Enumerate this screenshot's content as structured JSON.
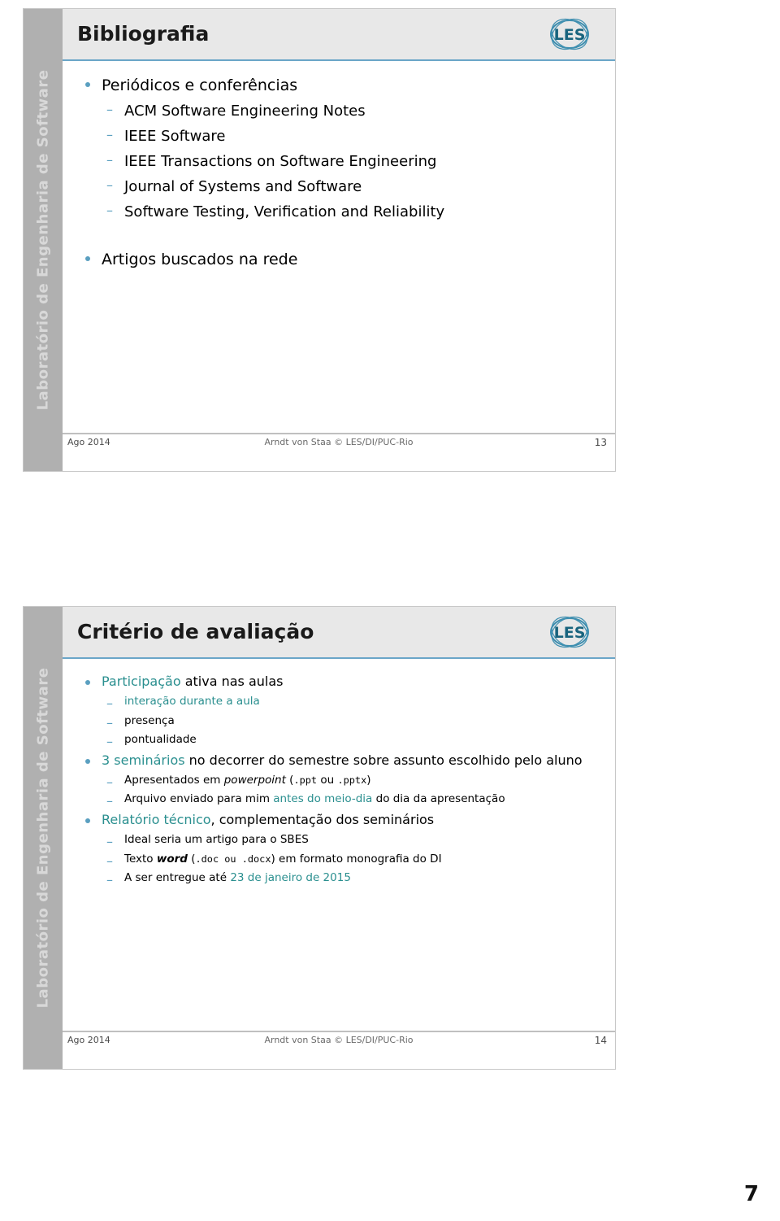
{
  "document": {
    "page_number": "7"
  },
  "slides": [
    {
      "title": "Bibliografia",
      "logo_text": "LES",
      "side_band": "Laboratório de Engenharia de Software",
      "bullets": [
        {
          "text": "Periódicos e conferências",
          "sub": [
            "ACM Software Engineering Notes",
            "IEEE Software",
            "IEEE Transactions on Software Engineering",
            "Journal of Systems and Software",
            "Software Testing, Verification and Reliability"
          ]
        },
        {
          "text": "Artigos buscados na rede",
          "sub": []
        }
      ],
      "footer": {
        "date": "Ago 2014",
        "center": "Arndt von Staa © LES/DI/PUC-Rio",
        "number": "13"
      }
    },
    {
      "title": "Critério de avaliação",
      "logo_text": "LES",
      "side_band": "Laboratório de Engenharia de Software",
      "groups": [
        {
          "bullet_parts": [
            {
              "text": "Participação",
              "style": "teal"
            },
            {
              "text": " ativa nas aulas",
              "style": "plain"
            }
          ],
          "sub": [
            [
              {
                "text": "interação durante a aula",
                "style": "teal"
              }
            ],
            [
              {
                "text": "presença",
                "style": "plain"
              }
            ],
            [
              {
                "text": "pontualidade",
                "style": "plain"
              }
            ]
          ]
        },
        {
          "bullet_parts": [
            {
              "text": "3 seminários",
              "style": "teal"
            },
            {
              "text": " no decorrer do semestre sobre assunto escolhido pelo aluno",
              "style": "plain"
            }
          ],
          "sub": [
            [
              {
                "text": "Apresentados em ",
                "style": "plain"
              },
              {
                "text": "powerpoint",
                "style": "ital"
              },
              {
                "text": " (",
                "style": "plain"
              },
              {
                "text": ".ppt",
                "style": "mono"
              },
              {
                "text": " ou ",
                "style": "plain"
              },
              {
                "text": ".pptx",
                "style": "mono"
              },
              {
                "text": ")",
                "style": "plain"
              }
            ],
            [
              {
                "text": "Arquivo enviado para mim ",
                "style": "plain"
              },
              {
                "text": "antes do meio-dia",
                "style": "teal"
              },
              {
                "text": " do dia da apresentação",
                "style": "plain"
              }
            ]
          ]
        },
        {
          "bullet_parts": [
            {
              "text": "Relatório técnico",
              "style": "teal"
            },
            {
              "text": ", complementação dos seminários",
              "style": "plain"
            }
          ],
          "sub": [
            [
              {
                "text": "Ideal seria um artigo para o SBES",
                "style": "plain"
              }
            ],
            [
              {
                "text": "Texto ",
                "style": "plain"
              },
              {
                "text": "word",
                "style": "bold-ital"
              },
              {
                "text": " (",
                "style": "plain"
              },
              {
                "text": ".doc",
                "style": "mono"
              },
              {
                "text": " ou ",
                "style": "mono"
              },
              {
                "text": ".docx",
                "style": "mono"
              },
              {
                "text": ") em formato monografia do DI",
                "style": "plain"
              }
            ],
            [
              {
                "text": "A ser entregue até ",
                "style": "plain"
              },
              {
                "text": "23 de janeiro de 2015",
                "style": "teal"
              }
            ]
          ]
        }
      ],
      "footer": {
        "date": "Ago 2014",
        "center": "Arndt von Staa © LES/DI/PUC-Rio",
        "number": "14"
      }
    }
  ]
}
